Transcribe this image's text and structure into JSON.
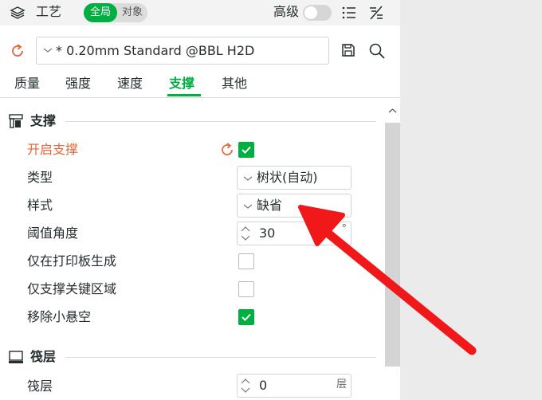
{
  "header": {
    "title": "工艺",
    "scope_global": "全局",
    "scope_object": "对象",
    "advanced_label": "高级"
  },
  "preset": {
    "value": "* 0.20mm Standard @BBL H2D"
  },
  "tabs": [
    {
      "label": "质量"
    },
    {
      "label": "强度"
    },
    {
      "label": "速度"
    },
    {
      "label": "支撑"
    },
    {
      "label": "其他"
    }
  ],
  "support_section": {
    "title": "支撑",
    "enable_label": "开启支撑",
    "enable_checked": true,
    "type_label": "类型",
    "type_value": "树状(自动)",
    "style_label": "样式",
    "style_value": "缺省",
    "threshold_label": "阈值角度",
    "threshold_value": "30",
    "threshold_unit": "°",
    "on_build_plate_label": "仅在打印板生成",
    "on_build_plate_checked": false,
    "critical_only_label": "仅支撑关键区域",
    "critical_only_checked": false,
    "remove_small_label": "移除小悬空",
    "remove_small_checked": true
  },
  "raft_section": {
    "title": "筏层",
    "layers_label": "筏层",
    "layers_value": "0",
    "layers_unit": "层"
  },
  "colors": {
    "accent": "#00ae42",
    "warn": "#e5643a",
    "annotation_arrow": "#f01818"
  }
}
